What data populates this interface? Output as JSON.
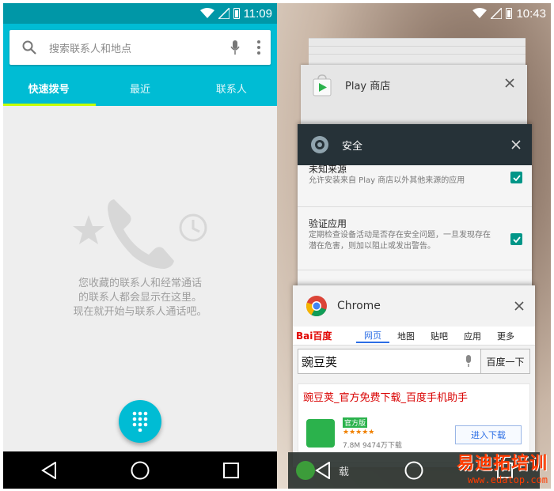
{
  "left": {
    "status": {
      "time": "11:09"
    },
    "search": {
      "placeholder": "搜索联系人和地点"
    },
    "tabs": [
      {
        "label": "快速拨号",
        "active": true
      },
      {
        "label": "最近",
        "active": false
      },
      {
        "label": "联系人",
        "active": false
      }
    ],
    "empty_lines": [
      "您收藏的联系人和经常通话",
      "的联系人都会显示在这里。",
      "现在就开始与联系人通话吧。"
    ],
    "accent": "#00bcd4"
  },
  "right": {
    "status": {
      "time": "10:43"
    },
    "play_card": {
      "title": "Play 商店"
    },
    "security_card": {
      "title": "安全",
      "items": [
        {
          "heading": "未知来源",
          "desc": "允许安装来自 Play 商店以外其他来源的应用"
        },
        {
          "heading": "验证应用",
          "desc": "定期检查设备活动是否存在安全问题，一旦发现存在潜在危害，则加以阻止或发出警告。"
        }
      ]
    },
    "chrome_card": {
      "title": "Chrome",
      "baidu_logo": "Bai百度",
      "nav": [
        "网页",
        "地图",
        "贴吧",
        "应用",
        "更多"
      ],
      "search_value": "豌豆荚",
      "search_button": "百度一下",
      "result_title": "豌豆荚_官方免费下载_百度手机助手",
      "result_badge": "官方版",
      "result_stars": "★★★★★",
      "result_meta": "7.8M    9474万下载",
      "result_button": "进入下载"
    },
    "download_bar": {
      "label": "载"
    },
    "watermark": {
      "title": "易迪拓培训",
      "url": "www.edatop.com"
    }
  }
}
